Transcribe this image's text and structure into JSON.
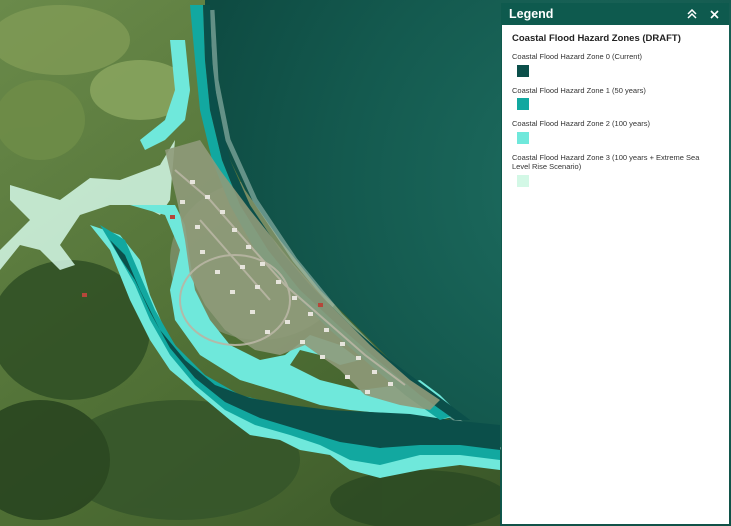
{
  "legend": {
    "title": "Legend",
    "layer_title": "Coastal Flood Hazard Zones (DRAFT)",
    "items": [
      {
        "label": "Coastal Flood Hazard Zone 0 (Current)",
        "color": "#0b4f4a"
      },
      {
        "label": "Coastal Flood Hazard Zone 1 (50 years)",
        "color": "#12a8a0"
      },
      {
        "label": "Coastal Flood Hazard Zone 2 (100 years)",
        "color": "#6fe8db"
      },
      {
        "label": "Coastal Flood Hazard Zone 3 (100 years + Extreme Sea Level Rise Scenario)",
        "color": "#d3f8e6"
      }
    ],
    "collapse_icon": "double-chevron-up-icon",
    "close_icon": "close-icon"
  },
  "colors": {
    "sea": "#11554b",
    "land": "#5a7a3c",
    "zone0": "#0b4f4a",
    "zone1": "#12a8a0",
    "zone2": "#6fe8db",
    "zone3": "#d3f8e6"
  }
}
